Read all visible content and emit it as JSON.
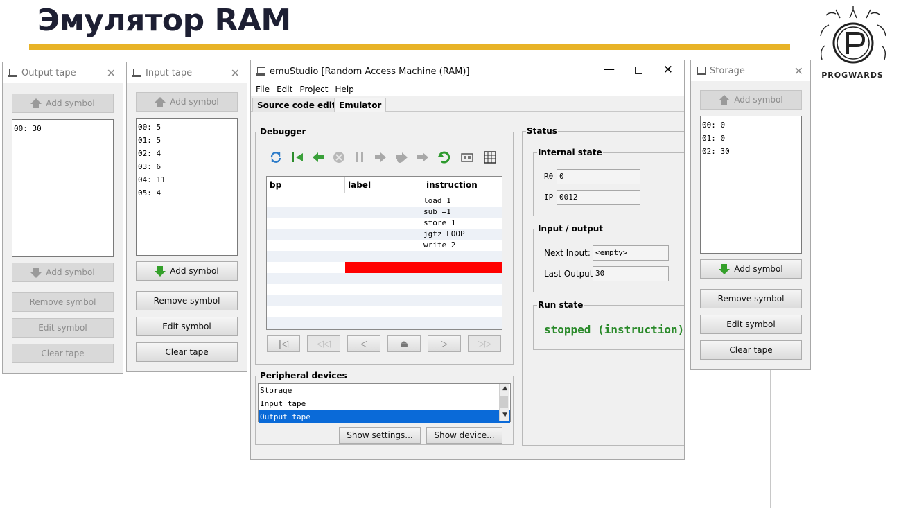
{
  "slide": {
    "title": "Эмулятор RAM",
    "logo_text": "PROGWARDS"
  },
  "colors": {
    "accent": "#e8b327",
    "selection": "#0a6ad8",
    "highlight": "#ff0000",
    "run_state": "#2a8a2a"
  },
  "output_tape": {
    "title": "Output tape",
    "add_top": "Add symbol",
    "cells": [
      "00: 30"
    ],
    "add_bottom": "Add symbol",
    "remove": "Remove symbol",
    "edit": "Edit symbol",
    "clear": "Clear tape"
  },
  "input_tape": {
    "title": "Input tape",
    "add_top": "Add symbol",
    "cells": [
      "00: 5",
      "01: 5",
      "02: 4",
      "03: 6",
      "04: 11",
      "05: 4"
    ],
    "add_bottom": "Add symbol",
    "remove": "Remove symbol",
    "edit": "Edit symbol",
    "clear": "Clear tape"
  },
  "storage": {
    "title": "Storage",
    "add_top": "Add symbol",
    "cells": [
      "00: 0",
      "01: 0",
      "02: 30"
    ],
    "add_bottom": "Add symbol",
    "remove": "Remove symbol",
    "edit": "Edit symbol",
    "clear": "Clear tape"
  },
  "main": {
    "title": "emuStudio [Random Access Machine (RAM)]",
    "menu": [
      "File",
      "Edit",
      "Project",
      "Help"
    ],
    "tabs": [
      "Source code editor",
      "Emulator"
    ],
    "debugger": {
      "label": "Debugger",
      "columns": [
        "bp",
        "label",
        "instruction"
      ],
      "instructions": [
        "load 1",
        "sub =1",
        "store 1",
        "jgtz LOOP",
        "write 2"
      ]
    },
    "peripheral": {
      "label": "Peripheral devices",
      "devices": [
        "Storage",
        "Input tape",
        "Output tape"
      ],
      "selected": "Output tape",
      "show_settings": "Show settings...",
      "show_device": "Show device..."
    },
    "status": {
      "label": "Status",
      "internal_state": "Internal state",
      "r0_label": "R0",
      "r0_value": "0",
      "ip_label": "IP",
      "ip_value": "0012",
      "io_label": "Input / output",
      "next_input_label": "Next Input:",
      "next_input_value": "<empty>",
      "last_output_label": "Last Output:",
      "last_output_value": "30",
      "run_state_label": "Run state",
      "run_state_value": "stopped (instruction)"
    }
  }
}
